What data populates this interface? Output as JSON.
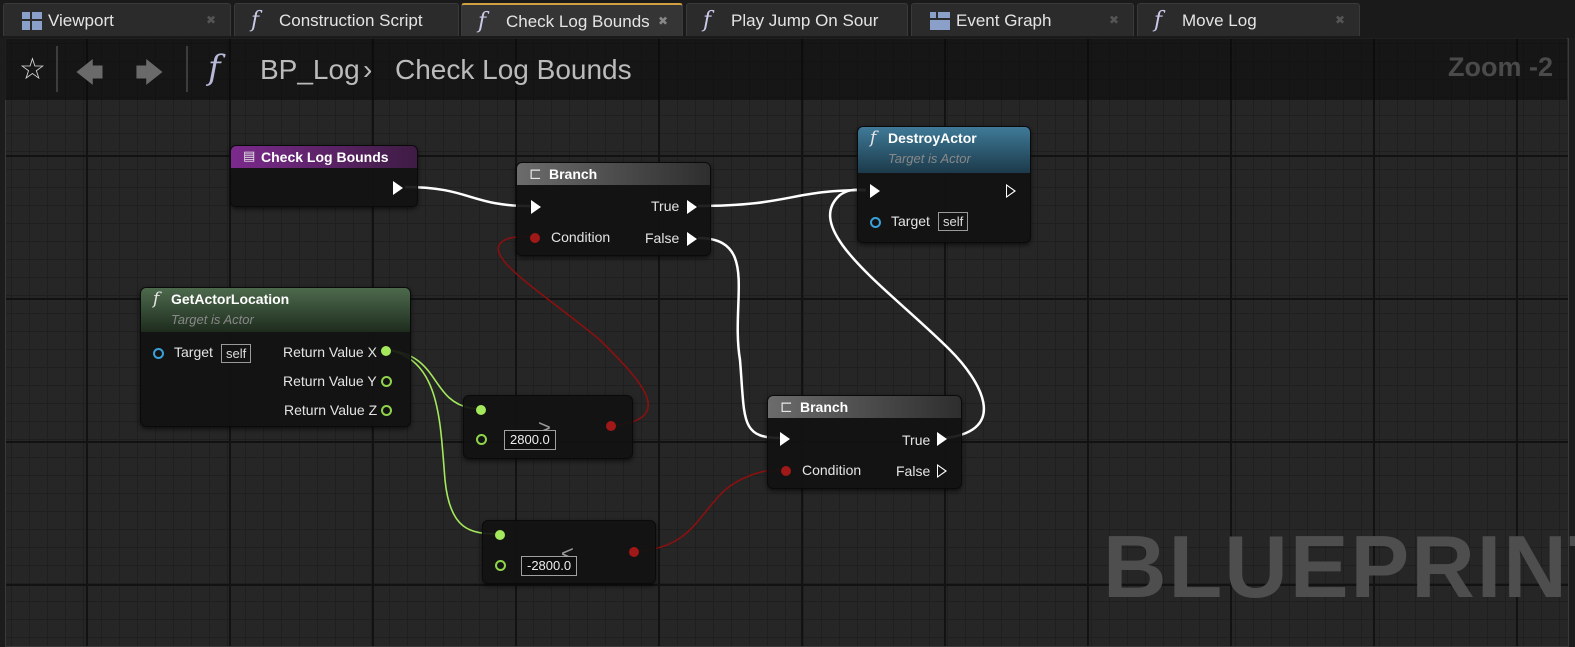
{
  "tabs": [
    {
      "label": "Viewport",
      "icon": "viewport-grid-icon"
    },
    {
      "label": "Construction Script",
      "icon": "function-icon"
    },
    {
      "label": "Check Log Bounds",
      "icon": "function-icon",
      "active": true
    },
    {
      "label": "Play Jump On Sour",
      "icon": "function-icon"
    },
    {
      "label": "Event Graph",
      "icon": "event-graph-icon"
    },
    {
      "label": "Move Log",
      "icon": "function-icon"
    }
  ],
  "header": {
    "blueprint": "BP_Log",
    "function_name": "Check Log Bounds",
    "zoom": "Zoom -2",
    "watermark": "BLUEPRINT"
  },
  "nodes": {
    "entry": {
      "title": "Check Log Bounds"
    },
    "branch1": {
      "title": "Branch",
      "true_label": "True",
      "false_label": "False",
      "condition_label": "Condition"
    },
    "destroy": {
      "title": "DestroyActor",
      "subtitle": "Target is Actor",
      "target_label": "Target",
      "self_value": "self"
    },
    "getloc": {
      "title": "GetActorLocation",
      "subtitle": "Target is Actor",
      "target_label": "Target",
      "self_value": "self",
      "x_label": "Return Value X",
      "y_label": "Return Value Y",
      "z_label": "Return Value Z"
    },
    "greater": {
      "operator": ">",
      "value": "2800.0"
    },
    "less": {
      "operator": "<",
      "value": "-2800.0"
    },
    "branch2": {
      "title": "Branch",
      "true_label": "True",
      "false_label": "False",
      "condition_label": "Condition"
    }
  },
  "colors": {
    "exec_wire": "#ffffff",
    "bool_wire": "#8a1010",
    "float_wire": "#a4e85c",
    "event_header": "#6a2a7a",
    "function_header_blue": "#3b6f8a",
    "function_header_green": "#3c5c3c",
    "branch_header": "#5a5a5a"
  }
}
